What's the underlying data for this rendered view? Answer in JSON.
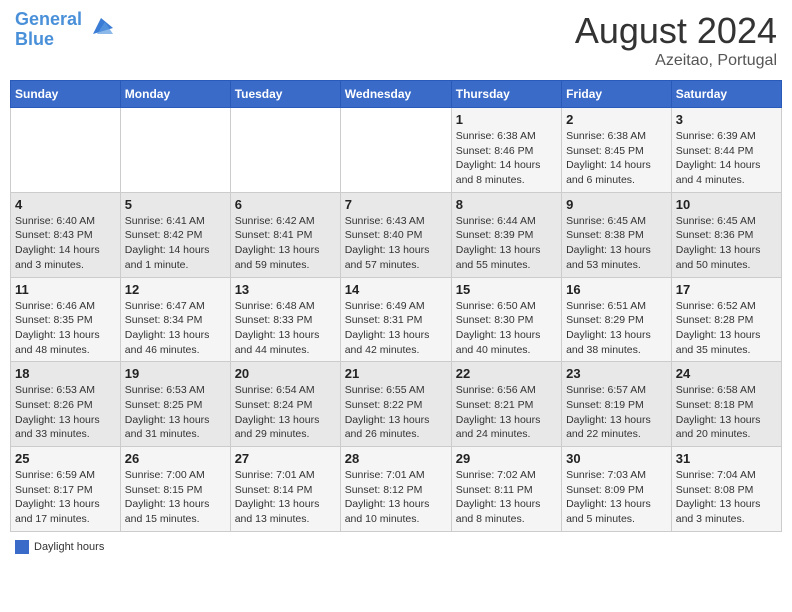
{
  "header": {
    "logo_line1": "General",
    "logo_line2": "Blue",
    "month": "August 2024",
    "location": "Azeitao, Portugal"
  },
  "footer": {
    "legend_label": "Daylight hours"
  },
  "days_of_week": [
    "Sunday",
    "Monday",
    "Tuesday",
    "Wednesday",
    "Thursday",
    "Friday",
    "Saturday"
  ],
  "weeks": [
    [
      {
        "num": "",
        "info": ""
      },
      {
        "num": "",
        "info": ""
      },
      {
        "num": "",
        "info": ""
      },
      {
        "num": "",
        "info": ""
      },
      {
        "num": "1",
        "info": "Sunrise: 6:38 AM\nSunset: 8:46 PM\nDaylight: 14 hours\nand 8 minutes."
      },
      {
        "num": "2",
        "info": "Sunrise: 6:38 AM\nSunset: 8:45 PM\nDaylight: 14 hours\nand 6 minutes."
      },
      {
        "num": "3",
        "info": "Sunrise: 6:39 AM\nSunset: 8:44 PM\nDaylight: 14 hours\nand 4 minutes."
      }
    ],
    [
      {
        "num": "4",
        "info": "Sunrise: 6:40 AM\nSunset: 8:43 PM\nDaylight: 14 hours\nand 3 minutes."
      },
      {
        "num": "5",
        "info": "Sunrise: 6:41 AM\nSunset: 8:42 PM\nDaylight: 14 hours\nand 1 minute."
      },
      {
        "num": "6",
        "info": "Sunrise: 6:42 AM\nSunset: 8:41 PM\nDaylight: 13 hours\nand 59 minutes."
      },
      {
        "num": "7",
        "info": "Sunrise: 6:43 AM\nSunset: 8:40 PM\nDaylight: 13 hours\nand 57 minutes."
      },
      {
        "num": "8",
        "info": "Sunrise: 6:44 AM\nSunset: 8:39 PM\nDaylight: 13 hours\nand 55 minutes."
      },
      {
        "num": "9",
        "info": "Sunrise: 6:45 AM\nSunset: 8:38 PM\nDaylight: 13 hours\nand 53 minutes."
      },
      {
        "num": "10",
        "info": "Sunrise: 6:45 AM\nSunset: 8:36 PM\nDaylight: 13 hours\nand 50 minutes."
      }
    ],
    [
      {
        "num": "11",
        "info": "Sunrise: 6:46 AM\nSunset: 8:35 PM\nDaylight: 13 hours\nand 48 minutes."
      },
      {
        "num": "12",
        "info": "Sunrise: 6:47 AM\nSunset: 8:34 PM\nDaylight: 13 hours\nand 46 minutes."
      },
      {
        "num": "13",
        "info": "Sunrise: 6:48 AM\nSunset: 8:33 PM\nDaylight: 13 hours\nand 44 minutes."
      },
      {
        "num": "14",
        "info": "Sunrise: 6:49 AM\nSunset: 8:31 PM\nDaylight: 13 hours\nand 42 minutes."
      },
      {
        "num": "15",
        "info": "Sunrise: 6:50 AM\nSunset: 8:30 PM\nDaylight: 13 hours\nand 40 minutes."
      },
      {
        "num": "16",
        "info": "Sunrise: 6:51 AM\nSunset: 8:29 PM\nDaylight: 13 hours\nand 38 minutes."
      },
      {
        "num": "17",
        "info": "Sunrise: 6:52 AM\nSunset: 8:28 PM\nDaylight: 13 hours\nand 35 minutes."
      }
    ],
    [
      {
        "num": "18",
        "info": "Sunrise: 6:53 AM\nSunset: 8:26 PM\nDaylight: 13 hours\nand 33 minutes."
      },
      {
        "num": "19",
        "info": "Sunrise: 6:53 AM\nSunset: 8:25 PM\nDaylight: 13 hours\nand 31 minutes."
      },
      {
        "num": "20",
        "info": "Sunrise: 6:54 AM\nSunset: 8:24 PM\nDaylight: 13 hours\nand 29 minutes."
      },
      {
        "num": "21",
        "info": "Sunrise: 6:55 AM\nSunset: 8:22 PM\nDaylight: 13 hours\nand 26 minutes."
      },
      {
        "num": "22",
        "info": "Sunrise: 6:56 AM\nSunset: 8:21 PM\nDaylight: 13 hours\nand 24 minutes."
      },
      {
        "num": "23",
        "info": "Sunrise: 6:57 AM\nSunset: 8:19 PM\nDaylight: 13 hours\nand 22 minutes."
      },
      {
        "num": "24",
        "info": "Sunrise: 6:58 AM\nSunset: 8:18 PM\nDaylight: 13 hours\nand 20 minutes."
      }
    ],
    [
      {
        "num": "25",
        "info": "Sunrise: 6:59 AM\nSunset: 8:17 PM\nDaylight: 13 hours\nand 17 minutes."
      },
      {
        "num": "26",
        "info": "Sunrise: 7:00 AM\nSunset: 8:15 PM\nDaylight: 13 hours\nand 15 minutes."
      },
      {
        "num": "27",
        "info": "Sunrise: 7:01 AM\nSunset: 8:14 PM\nDaylight: 13 hours\nand 13 minutes."
      },
      {
        "num": "28",
        "info": "Sunrise: 7:01 AM\nSunset: 8:12 PM\nDaylight: 13 hours\nand 10 minutes."
      },
      {
        "num": "29",
        "info": "Sunrise: 7:02 AM\nSunset: 8:11 PM\nDaylight: 13 hours\nand 8 minutes."
      },
      {
        "num": "30",
        "info": "Sunrise: 7:03 AM\nSunset: 8:09 PM\nDaylight: 13 hours\nand 5 minutes."
      },
      {
        "num": "31",
        "info": "Sunrise: 7:04 AM\nSunset: 8:08 PM\nDaylight: 13 hours\nand 3 minutes."
      }
    ]
  ]
}
